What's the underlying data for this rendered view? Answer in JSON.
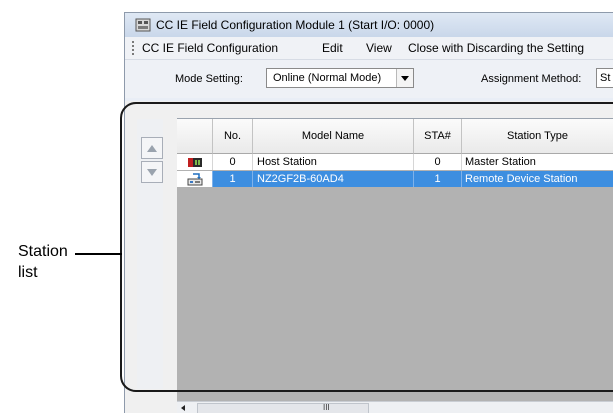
{
  "window": {
    "title": "CC IE Field Configuration Module 1 (Start I/O: 0000)"
  },
  "menu": {
    "items": [
      "CC IE Field Configuration",
      "Edit",
      "View",
      "Close with Discarding the Setting"
    ]
  },
  "toolbar": {
    "mode_label": "Mode Setting:",
    "mode_value": "Online (Normal Mode)",
    "assignment_label": "Assignment Method:",
    "assignment_value": "St"
  },
  "table": {
    "headers": {
      "no": "No.",
      "model": "Model Name",
      "sta": "STA#",
      "type": "Station Type"
    },
    "rows": [
      {
        "no": "0",
        "model": "Host Station",
        "sta": "0",
        "type": "Master Station",
        "icon": "master-station-icon",
        "selected": false
      },
      {
        "no": "1",
        "model": "NZ2GF2B-60AD4",
        "sta": "1",
        "type": "Remote Device Station",
        "icon": "remote-device-icon",
        "selected": true
      }
    ]
  },
  "scrollbar": {
    "grip": "III"
  },
  "callout": {
    "line1": "Station",
    "line2": "list"
  },
  "colors": {
    "selected_row": "#3d8ee0",
    "grid_background": "#b2b2b2"
  }
}
